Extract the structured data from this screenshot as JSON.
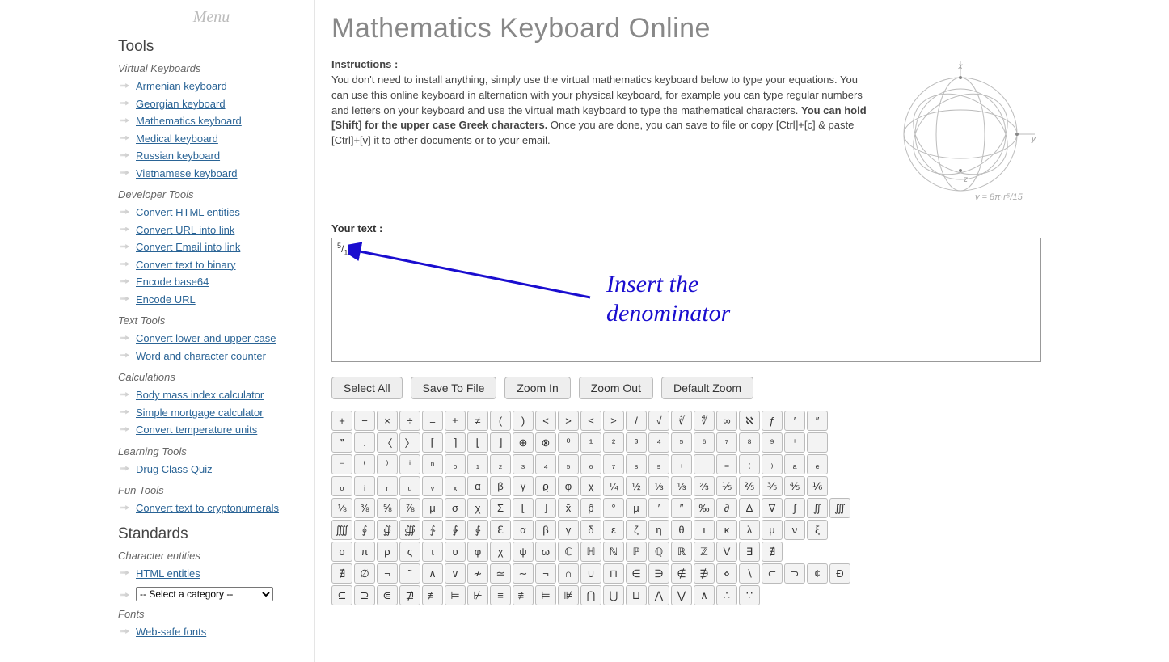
{
  "menu_label": "Menu",
  "sidebar": {
    "heading_tools": "Tools",
    "virtual_keyboards": {
      "title": "Virtual Keyboards",
      "items": [
        "Armenian keyboard",
        "Georgian keyboard",
        "Mathematics keyboard",
        "Medical keyboard",
        "Russian keyboard",
        "Vietnamese keyboard"
      ]
    },
    "developer_tools": {
      "title": "Developer Tools",
      "items": [
        "Convert HTML entities",
        "Convert URL into link",
        "Convert Email into link",
        "Convert text to binary",
        "Encode base64",
        "Encode URL"
      ]
    },
    "text_tools": {
      "title": "Text Tools",
      "items": [
        "Convert lower and upper case",
        "Word and character counter"
      ]
    },
    "calculations": {
      "title": "Calculations",
      "items": [
        "Body mass index calculator",
        "Simple mortgage calculator",
        "Convert temperature units"
      ]
    },
    "learning_tools": {
      "title": "Learning Tools",
      "items": [
        "Drug Class Quiz"
      ]
    },
    "fun_tools": {
      "title": "Fun Tools",
      "items": [
        "Convert text to cryptonumerals"
      ]
    },
    "heading_standards": "Standards",
    "character_entities": {
      "title": "Character entities",
      "items": [
        "HTML entities"
      ],
      "select_placeholder": "-- Select a category --"
    },
    "fonts": {
      "title": "Fonts",
      "items": [
        "Web-safe fonts"
      ]
    }
  },
  "main": {
    "title": "Mathematics Keyboard Online",
    "instructions_label": "Instructions :",
    "instructions_p1": "You don't need to install anything, simply use the virtual mathematics keyboard below to type your equations. You can use this online keyboard in alternation with your physical keyboard, for example you can type regular numbers and letters on your keyboard and use the virtual math keyboard to type the mathematical characters. ",
    "instructions_bold": "You can hold [Shift] for the upper case Greek characters.",
    "instructions_p2": " Once you are done, you can save to file or copy [Ctrl]+[c] & paste [Ctrl]+[v] it to other documents or to your email.",
    "your_text_label": "Your text :",
    "textarea_value_numerator": "5",
    "textarea_value_slash": "/",
    "textarea_value_denominator": "15",
    "annotation": "Insert the\ndenominator",
    "buttons": {
      "select_all": "Select All",
      "save_to_file": "Save To File",
      "zoom_in": "Zoom In",
      "zoom_out": "Zoom Out",
      "default_zoom": "Default Zoom"
    },
    "keyboard_rows": [
      [
        "+",
        "−",
        "×",
        "÷",
        "=",
        "±",
        "≠",
        "(",
        ")",
        "<",
        ">",
        "≤",
        "≥",
        "/",
        "√",
        "∛",
        "∜",
        "∞",
        "ℵ",
        "ƒ",
        "′",
        "″"
      ],
      [
        "‴",
        ".",
        "〈",
        "〉",
        "⌈",
        "⌉",
        "⌊",
        "⌋",
        "⊕",
        "⊗",
        "⁰",
        "¹",
        "²",
        "³",
        "⁴",
        "⁵",
        "⁶",
        "⁷",
        "⁸",
        "⁹",
        "⁺",
        "⁻"
      ],
      [
        "⁼",
        "⁽",
        "⁾",
        "ⁱ",
        "ⁿ",
        "₀",
        "₁",
        "₂",
        "₃",
        "₄",
        "₅",
        "₆",
        "₇",
        "₈",
        "₉",
        "₊",
        "₋",
        "₌",
        "₍",
        "₎",
        "ₐ",
        "ₑ"
      ],
      [
        "ₒ",
        "ᵢ",
        "ᵣ",
        "ᵤ",
        "ᵥ",
        "ₓ",
        "α",
        "β",
        "γ",
        "ϱ",
        "φ",
        "χ",
        "¼",
        "½",
        "⅓",
        "⅓",
        "⅔",
        "⅕",
        "⅖",
        "⅗",
        "⅘",
        "⅙"
      ],
      [
        "⅛",
        "⅜",
        "⅝",
        "⅞",
        "μ",
        "σ",
        "χ",
        "Σ",
        "⌊",
        "⌋",
        "x̄",
        "p̂",
        "°",
        "μ",
        "′",
        "″",
        "‰",
        "∂",
        "Δ",
        "∇",
        "∫",
        "∬",
        "∭"
      ],
      [
        "⨌",
        "∮",
        "∯",
        "∰",
        "∱",
        "∲",
        "∳",
        "ℇ",
        "α",
        "β",
        "γ",
        "δ",
        "ε",
        "ζ",
        "η",
        "θ",
        "ι",
        "κ",
        "λ",
        "μ",
        "ν",
        "ξ"
      ],
      [
        "ο",
        "π",
        "ρ",
        "ς",
        "τ",
        "υ",
        "φ",
        "χ",
        "ψ",
        "ω",
        "ℂ",
        "ℍ",
        "ℕ",
        "ℙ",
        "ℚ",
        "ℝ",
        "ℤ",
        "∀",
        "∃",
        "∄"
      ],
      [
        "∄",
        "∅",
        "¬",
        "˜",
        "∧",
        "∨",
        "≁",
        "≃",
        "∼",
        "¬",
        "∩",
        "∪",
        "⊓",
        "∈",
        "∋",
        "∉",
        "∌",
        "⋄",
        "∖",
        "⊂",
        "⊃",
        "¢",
        "Ð"
      ],
      [
        "⊆",
        "⊇",
        "⋐",
        "⋣",
        "≢",
        "⊨",
        "⊬",
        "≡",
        "≢",
        "⊨",
        "⊯",
        "⋂",
        "⋃",
        "⊔",
        "⋀",
        "⋁",
        "∧",
        "∴",
        "∵"
      ]
    ],
    "cube_labels": {
      "x": "x",
      "y": "y",
      "z": "z",
      "formula": "v = 8π·r⁵/15"
    }
  }
}
